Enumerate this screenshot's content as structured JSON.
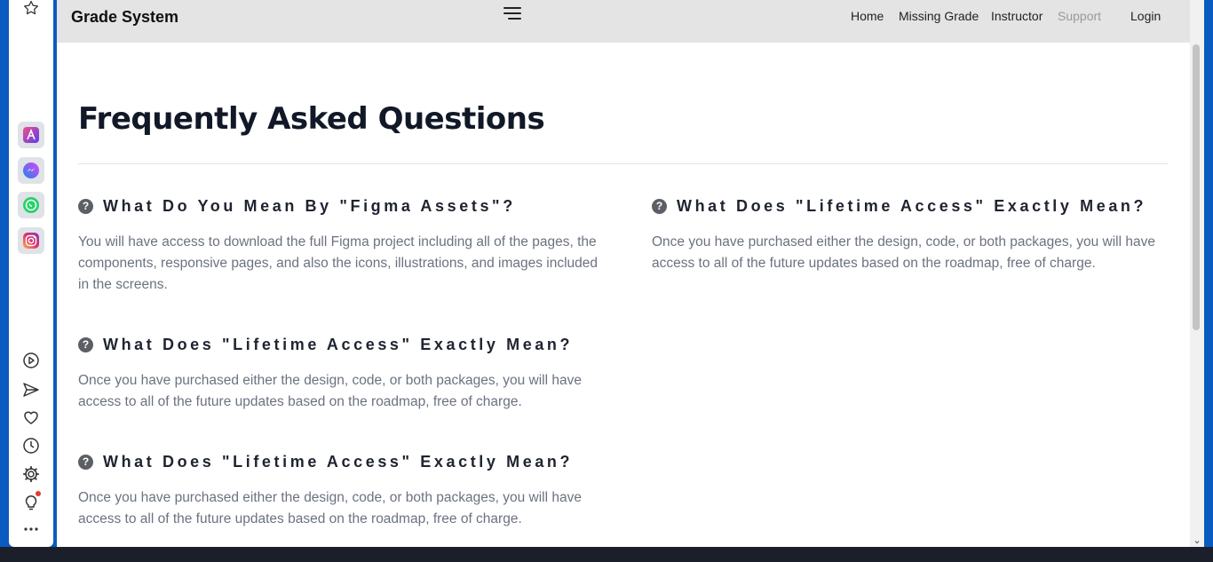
{
  "navbar": {
    "brand": "Grade System",
    "links": [
      "Home",
      "Missing Grade",
      "Instructor",
      "Support",
      "Login"
    ]
  },
  "faq": {
    "title": "Frequently Asked Questions",
    "items": [
      {
        "question": "What Do You Mean By \"Figma Assets\"?",
        "answer": "You will have access to download the full Figma project including all of the pages, the components, responsive pages, and also the icons, illustrations, and images included in the screens."
      },
      {
        "question": "What Does \"Lifetime Access\" Exactly Mean?",
        "answer": "Once you have purchased either the design, code, or both packages, you will have access to all of the future updates based on the roadmap, free of charge."
      },
      {
        "question": "What Does \"Lifetime Access\" Exactly Mean?",
        "answer": "Once you have purchased either the design, code, or both packages, you will have access to all of the future updates based on the roadmap, free of charge."
      },
      {
        "question": "What Does \"Lifetime Access\" Exactly Mean?",
        "answer": "Once you have purchased either the design, code, or both packages, you will have access to all of the future updates based on the roadmap, free of charge."
      }
    ]
  },
  "sidebar": {
    "icons": [
      "star-icon",
      "aria-icon",
      "messenger-icon",
      "whatsapp-icon",
      "instagram-icon",
      "play-icon",
      "send-icon",
      "heart-icon",
      "clock-icon",
      "gear-icon",
      "lightbulb-icon",
      "more-icon"
    ]
  },
  "colors": {
    "navbar_bg": "#e4e4e4",
    "title": "#111827",
    "answer_text": "#6b7280",
    "muted_link": "#9a9a9a",
    "window_frame": "#0a5bbf"
  }
}
